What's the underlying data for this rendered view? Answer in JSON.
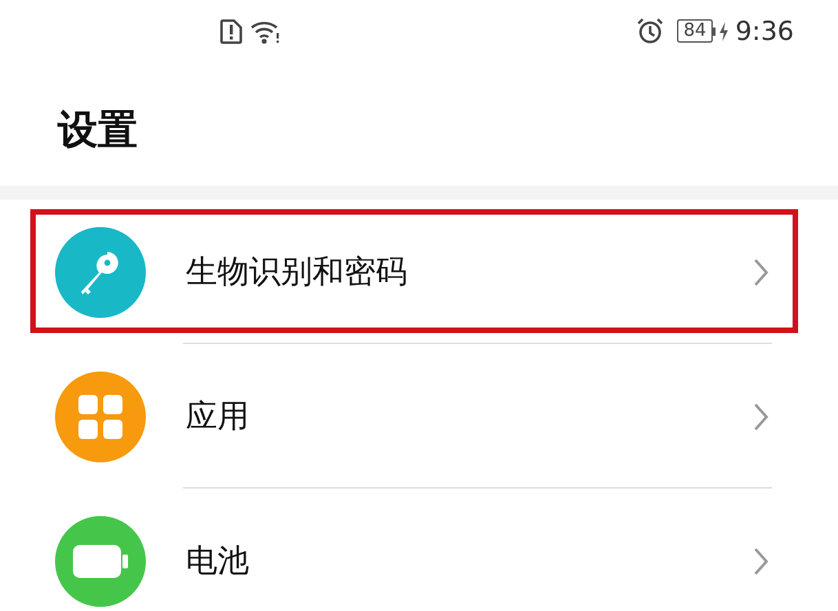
{
  "status_bar": {
    "battery": "84",
    "time": "9:36"
  },
  "title": "设置",
  "items": [
    {
      "label": "生物识别和密码",
      "color": "#19b8c7",
      "highlighted": true
    },
    {
      "label": "应用",
      "color": "#f79a0e",
      "highlighted": false
    },
    {
      "label": "电池",
      "color": "#45c64b",
      "highlighted": false
    }
  ]
}
